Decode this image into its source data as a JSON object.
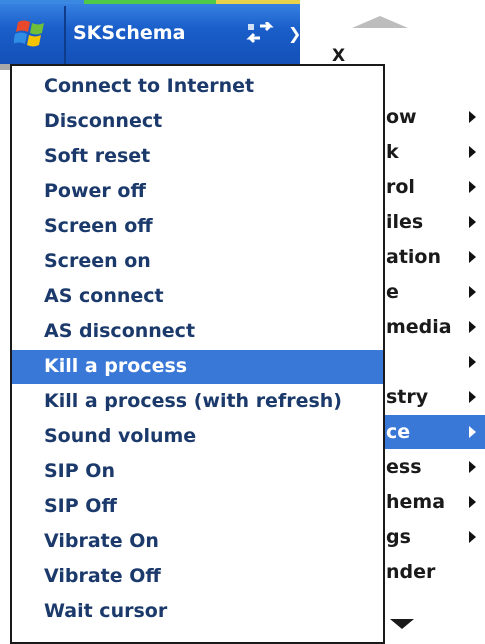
{
  "titlebar": {
    "app_title": "SKSchema",
    "vol_glyph": "❯"
  },
  "icons": {
    "start": "windows-flag-icon",
    "connectivity": "connectivity-arrows-icon",
    "volume": "volume-icon",
    "scroll_up": "scroll-up-arrow-icon",
    "scroll_down": "scroll-down-arrow-icon"
  },
  "colors": {
    "titlebar": "#1a5ec9",
    "selection": "#3a78d8",
    "menu_text": "#1b3a6b"
  },
  "main_menu": {
    "items": [
      {
        "label": "X",
        "submenu": false,
        "selected": false
      },
      {
        "label": "ow",
        "submenu": true,
        "selected": false
      },
      {
        "label": "k",
        "submenu": true,
        "selected": false
      },
      {
        "label": "rol",
        "submenu": true,
        "selected": false
      },
      {
        "label": "iles",
        "submenu": true,
        "selected": false
      },
      {
        "label": "ation",
        "submenu": true,
        "selected": false
      },
      {
        "label": "e",
        "submenu": true,
        "selected": false
      },
      {
        "label": "media",
        "submenu": true,
        "selected": false
      },
      {
        "label": "",
        "submenu": true,
        "selected": false
      },
      {
        "label": "stry",
        "submenu": true,
        "selected": false
      },
      {
        "label": "ce",
        "submenu": true,
        "selected": true
      },
      {
        "label": "ess",
        "submenu": true,
        "selected": false
      },
      {
        "label": "hema",
        "submenu": true,
        "selected": false
      },
      {
        "label": "gs",
        "submenu": true,
        "selected": false
      },
      {
        "label": "nder",
        "submenu": false,
        "selected": false
      }
    ]
  },
  "popup_menu": {
    "items": [
      {
        "label": "Connect to Internet",
        "selected": false
      },
      {
        "label": "Disconnect",
        "selected": false
      },
      {
        "label": "Soft reset",
        "selected": false
      },
      {
        "label": "Power off",
        "selected": false
      },
      {
        "label": "Screen off",
        "selected": false
      },
      {
        "label": "Screen on",
        "selected": false
      },
      {
        "label": "AS connect",
        "selected": false
      },
      {
        "label": "AS disconnect",
        "selected": false
      },
      {
        "label": "Kill a process",
        "selected": true
      },
      {
        "label": "Kill a process (with refresh)",
        "selected": false
      },
      {
        "label": "Sound volume",
        "selected": false
      },
      {
        "label": "SIP On",
        "selected": false
      },
      {
        "label": "SIP Off",
        "selected": false
      },
      {
        "label": "Vibrate On",
        "selected": false
      },
      {
        "label": "Vibrate Off",
        "selected": false
      },
      {
        "label": "Wait cursor",
        "selected": false
      }
    ]
  }
}
